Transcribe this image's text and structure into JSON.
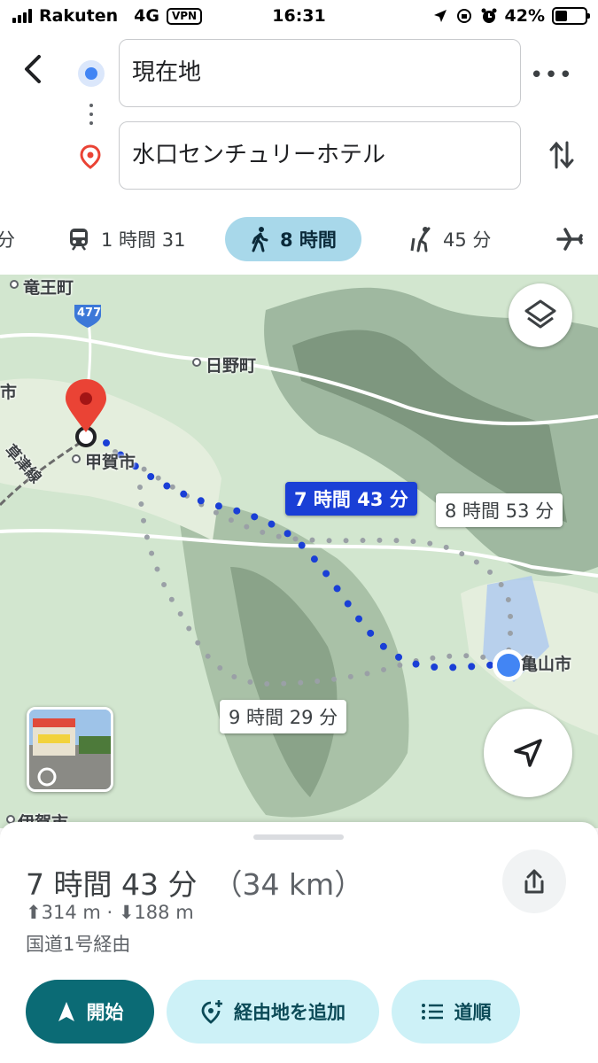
{
  "status": {
    "carrier": "Rakuten",
    "network": "4G",
    "vpn": "VPN",
    "time": "16:31",
    "battery": "42%",
    "battery_level": 0.42
  },
  "search": {
    "origin": "現在地",
    "destination": "水口センチュリーホテル",
    "back_icon": "back-arrow-icon",
    "more_icon": "more-horizontal-icon",
    "swap_icon": "swap-vertical-icon"
  },
  "modes": [
    {
      "icon": "car-icon",
      "label": "分",
      "active": false
    },
    {
      "icon": "train-icon",
      "label": "1 時間 31",
      "active": false
    },
    {
      "icon": "walk-icon",
      "label": "8 時間",
      "active": true
    },
    {
      "icon": "rideshare-icon",
      "label": "45 分",
      "active": false
    },
    {
      "icon": "flight-icon",
      "label": "",
      "active": false
    }
  ],
  "map": {
    "labels": {
      "ryuo": "竜王町",
      "hino": "日野町",
      "koka": "甲賀市",
      "kameyama": "亀山市",
      "iga": "伊賀市",
      "shi_left": "市",
      "rail": "草津線",
      "road_477": "477"
    },
    "routes": {
      "selected": "7 時間 43 分",
      "alt1": "8 時間 53 分",
      "alt2": "9 時間 29 分"
    }
  },
  "sheet": {
    "duration": "7 時間 43 分",
    "distance": "（34 km）",
    "elevation": "⬆314 m · ⬇188 m",
    "via": "国道1号経由",
    "buttons": {
      "start": "開始",
      "add_stop": "経由地を追加",
      "steps": "道順"
    }
  },
  "colors": {
    "accent": "#0b6b75",
    "route_selected": "#1a3fd6",
    "pill_bg": "#cdf1f7",
    "active_mode_bg": "#a8d8ea"
  }
}
